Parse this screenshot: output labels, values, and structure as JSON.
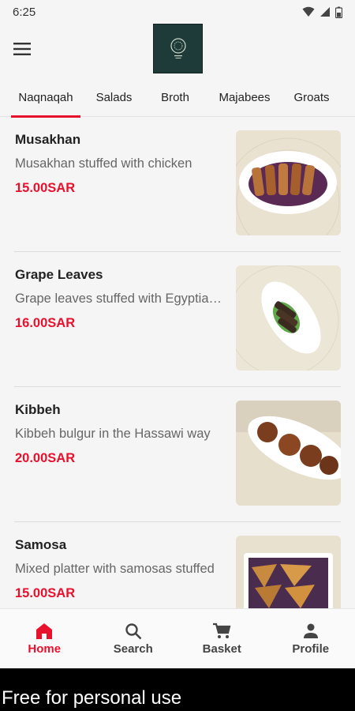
{
  "status_bar": {
    "time": "6:25"
  },
  "tabs": [
    {
      "label": "Naqnaqah",
      "active": true
    },
    {
      "label": "Salads",
      "active": false
    },
    {
      "label": "Broth",
      "active": false
    },
    {
      "label": "Majabees",
      "active": false
    },
    {
      "label": "Groats",
      "active": false
    }
  ],
  "items": [
    {
      "name": "Musakhan",
      "description": "Musakhan stuffed with chicken",
      "price": "15.00SAR"
    },
    {
      "name": "Grape Leaves",
      "description": "Grape leaves stuffed with Egyptian rice",
      "price": "16.00SAR"
    },
    {
      "name": "Kibbeh",
      "description": "Kibbeh bulgur in the Hassawi way",
      "price": "20.00SAR"
    },
    {
      "name": "Samosa",
      "description": "Mixed platter with samosas stuffed",
      "price": "15.00SAR"
    }
  ],
  "bottom_nav": [
    {
      "label": "Home",
      "icon": "home-icon",
      "active": true
    },
    {
      "label": "Search",
      "icon": "search-icon",
      "active": false
    },
    {
      "label": "Basket",
      "icon": "cart-icon",
      "active": false
    },
    {
      "label": "Profile",
      "icon": "person-icon",
      "active": false
    }
  ],
  "watermark": "Free for personal use",
  "colors": {
    "accent": "#e8112d",
    "background": "#f5f5f5",
    "logo_bg": "#1e3b3a"
  }
}
